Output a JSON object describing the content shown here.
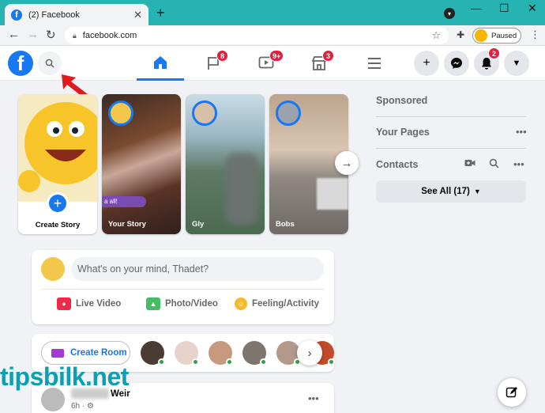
{
  "browser": {
    "tab_title": "(2) Facebook",
    "tab_icon": "facebook-icon",
    "url": "facebook.com",
    "profile_status": "Paused"
  },
  "fb": {
    "nav": [
      {
        "name": "home-icon",
        "badge": ""
      },
      {
        "name": "pages-flag-icon",
        "badge": "8"
      },
      {
        "name": "watch-video-icon",
        "badge": "9+"
      },
      {
        "name": "marketplace-icon",
        "badge": "3"
      },
      {
        "name": "menu-icon",
        "badge": ""
      }
    ],
    "notification_badge": "2",
    "accent": "#1877f2",
    "badge_color": "#e41e3f"
  },
  "stories": [
    {
      "label": "Create Story"
    },
    {
      "label": "Your Story"
    },
    {
      "label": "Gly"
    },
    {
      "label": "Bobs"
    }
  ],
  "story_sticker": "a all!",
  "composer": {
    "placeholder": "What's on your mind, Thadet?",
    "actions": [
      {
        "label": "Live Video",
        "icon": "live-video-icon",
        "color": "#f02849"
      },
      {
        "label": "Photo/Video",
        "icon": "photo-icon",
        "color": "#45bd62"
      },
      {
        "label": "Feeling/Activity",
        "icon": "feeling-icon",
        "color": "#f7b928"
      }
    ]
  },
  "rooms": {
    "create_label": "Create Room"
  },
  "post": {
    "name": "Weir",
    "time": "6h ·"
  },
  "sidebar": {
    "sponsored": "Sponsored",
    "your_pages": "Your Pages",
    "contacts": "Contacts",
    "see_all": "See All (17)"
  },
  "watermark": "tipsbilk.net"
}
